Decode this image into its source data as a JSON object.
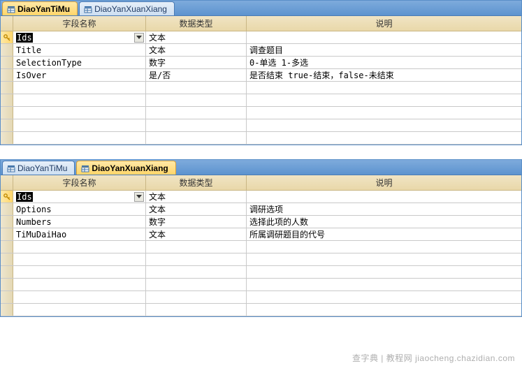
{
  "panels": [
    {
      "tabs": [
        {
          "label": "DiaoYanTiMu",
          "active": true
        },
        {
          "label": "DiaoYanXuanXiang",
          "active": false
        }
      ],
      "headers": {
        "name": "字段名称",
        "type": "数据类型",
        "desc": "说明"
      },
      "rows": [
        {
          "pk": true,
          "name": "Ids",
          "type": "文本",
          "desc": "",
          "selected": true,
          "dropdown": true
        },
        {
          "pk": false,
          "name": "Title",
          "type": "文本",
          "desc": "调查题目"
        },
        {
          "pk": false,
          "name": "SelectionType",
          "type": "数字",
          "desc": "0-单选 1-多选"
        },
        {
          "pk": false,
          "name": "IsOver",
          "type": "是/否",
          "desc": "是否结束 true-结束，false-未结束"
        }
      ],
      "empty_rows": 5
    },
    {
      "tabs": [
        {
          "label": "DiaoYanTiMu",
          "active": false
        },
        {
          "label": "DiaoYanXuanXiang",
          "active": true
        }
      ],
      "headers": {
        "name": "字段名称",
        "type": "数据类型",
        "desc": "说明"
      },
      "rows": [
        {
          "pk": true,
          "name": "Ids",
          "type": "文本",
          "desc": "",
          "selected": true,
          "dropdown": true
        },
        {
          "pk": false,
          "name": "Options",
          "type": "文本",
          "desc": "调研选项"
        },
        {
          "pk": false,
          "name": "Numbers",
          "type": "数字",
          "desc": "选择此项的人数"
        },
        {
          "pk": false,
          "name": "TiMuDaiHao",
          "type": "文本",
          "desc": "所属调研题目的代号"
        }
      ],
      "empty_rows": 6
    }
  ],
  "watermark": "查字典 | 教程网   jiaocheng.chazidian.com"
}
